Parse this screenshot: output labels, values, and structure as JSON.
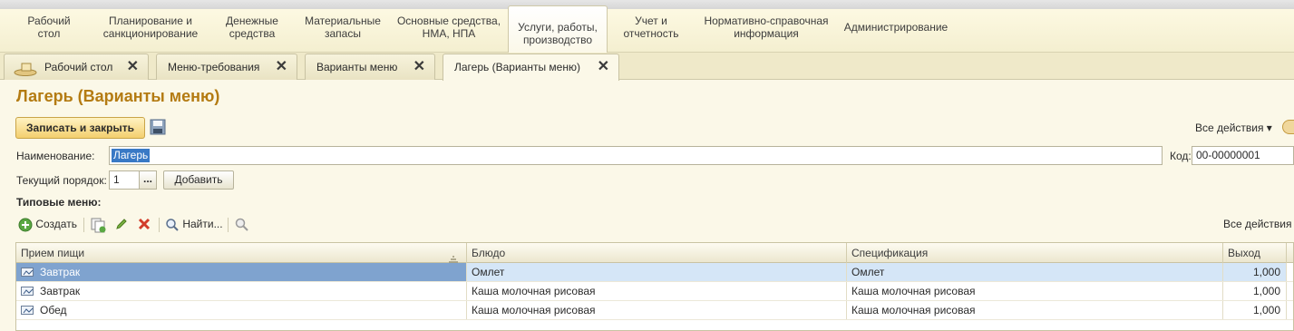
{
  "sections": [
    {
      "line1": "Рабочий",
      "line2": "стол"
    },
    {
      "line1": "Планирование и",
      "line2": "санкционирование"
    },
    {
      "line1": "Денежные",
      "line2": "средства"
    },
    {
      "line1": "Материальные",
      "line2": "запасы"
    },
    {
      "line1": "Основные средства,",
      "line2": "НМА, НПА"
    },
    {
      "line1": "Услуги, работы,",
      "line2": "производство"
    },
    {
      "line1": "Учет и",
      "line2": "отчетность"
    },
    {
      "line1": "Нормативно-справочная",
      "line2": "информация"
    },
    {
      "line1": "Администрирование",
      "line2": ""
    }
  ],
  "tabs": [
    {
      "label": "Рабочий стол"
    },
    {
      "label": "Меню-требования"
    },
    {
      "label": "Варианты меню"
    },
    {
      "label": "Лагерь (Варианты меню)"
    }
  ],
  "tab_close": "✕",
  "form": {
    "title": "Лагерь (Варианты меню)",
    "save_close": "Записать и закрыть",
    "all_actions": "Все действия ▾",
    "name_label": "Наименование:",
    "name_value": "Лагерь",
    "code_label": "Код:",
    "code_value": "00-00000001",
    "order_label": "Текущий порядок:",
    "order_value": "1",
    "choose_btn": "...",
    "add_btn": "Добавить",
    "typical_menu_label": "Типовые меню:"
  },
  "toolbar": {
    "create": "Создать",
    "find": "Найти...",
    "all_actions": "Все действия"
  },
  "table": {
    "columns": [
      "Прием пищи",
      "Блюдо",
      "Спецификация",
      "Выход"
    ],
    "rows": [
      [
        "Завтрак",
        "Омлет",
        "Омлет",
        "1,000"
      ],
      [
        "Завтрак",
        "Каша молочная рисовая",
        "Каша молочная рисовая",
        "1,000"
      ],
      [
        "Обед",
        "Каша молочная рисовая",
        "Каша молочная рисовая",
        "1,000"
      ]
    ],
    "selected_row": 0
  },
  "colors": {
    "title": "#b47b12",
    "background": "#fbf8e8",
    "selection": "#3979c5"
  }
}
